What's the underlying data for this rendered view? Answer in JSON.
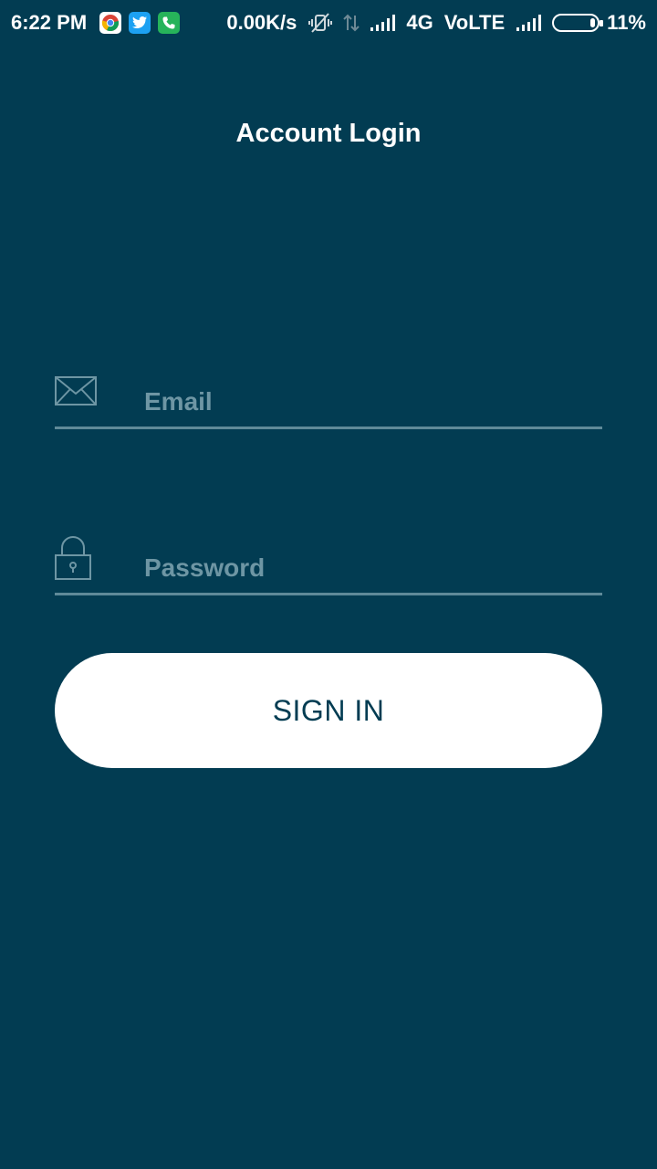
{
  "status_bar": {
    "time": "6:22 PM",
    "network_speed": "0.00K/s",
    "network_type": "4G",
    "volte_label": "VoLTE",
    "battery_percent": "11%",
    "battery_level": 0.11,
    "notification_icons": [
      "chrome-icon",
      "twitter-icon",
      "phone-icon"
    ],
    "system_icons": [
      "vibrate-off-icon",
      "data-arrows-icon",
      "signal-icon",
      "signal-icon",
      "battery-icon"
    ]
  },
  "header": {
    "title": "Account Login"
  },
  "form": {
    "email": {
      "placeholder": "Email",
      "value": "",
      "icon": "envelope-icon"
    },
    "password": {
      "placeholder": "Password",
      "value": "",
      "icon": "lock-icon"
    },
    "submit_label": "SIGN IN"
  },
  "colors": {
    "background": "#023c52",
    "underline": "#5f8a99",
    "placeholder": "#6e96a4",
    "button_bg": "#ffffff",
    "button_text": "#023c52"
  }
}
